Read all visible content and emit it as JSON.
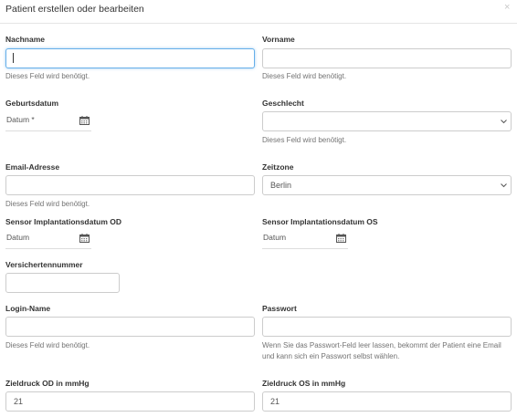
{
  "modal": {
    "title": "Patient erstellen oder bearbeiten",
    "close": "×"
  },
  "required_hint": "Dieses Feld wird benötigt.",
  "fields": {
    "nachname": {
      "label": "Nachname",
      "value": ""
    },
    "vorname": {
      "label": "Vorname",
      "value": ""
    },
    "geburtsdatum": {
      "label": "Geburtsdatum",
      "placeholder": "Datum *"
    },
    "geschlecht": {
      "label": "Geschlecht",
      "value": ""
    },
    "email": {
      "label": "Email-Adresse",
      "value": ""
    },
    "zeitzone": {
      "label": "Zeitzone",
      "value": "Berlin"
    },
    "sensor_od": {
      "label": "Sensor Implantationsdatum OD",
      "placeholder": "Datum"
    },
    "sensor_os": {
      "label": "Sensor Implantationsdatum OS",
      "placeholder": "Datum"
    },
    "versichertennummer": {
      "label": "Versichertennummer",
      "value": ""
    },
    "login": {
      "label": "Login-Name",
      "value": ""
    },
    "passwort": {
      "label": "Passwort",
      "value": "",
      "hint": "Wenn Sie das Passwort-Feld leer lassen, bekommt der Patient eine Email und kann sich ein Passwort selbst wählen."
    },
    "zieldruck_od": {
      "label": "Zieldruck OD in mmHg",
      "value": "21"
    },
    "zieldruck_os": {
      "label": "Zieldruck OS in mmHg",
      "value": "21"
    }
  },
  "icons": {
    "calendar": "calendar-icon",
    "select": "chevron-down-icon"
  }
}
